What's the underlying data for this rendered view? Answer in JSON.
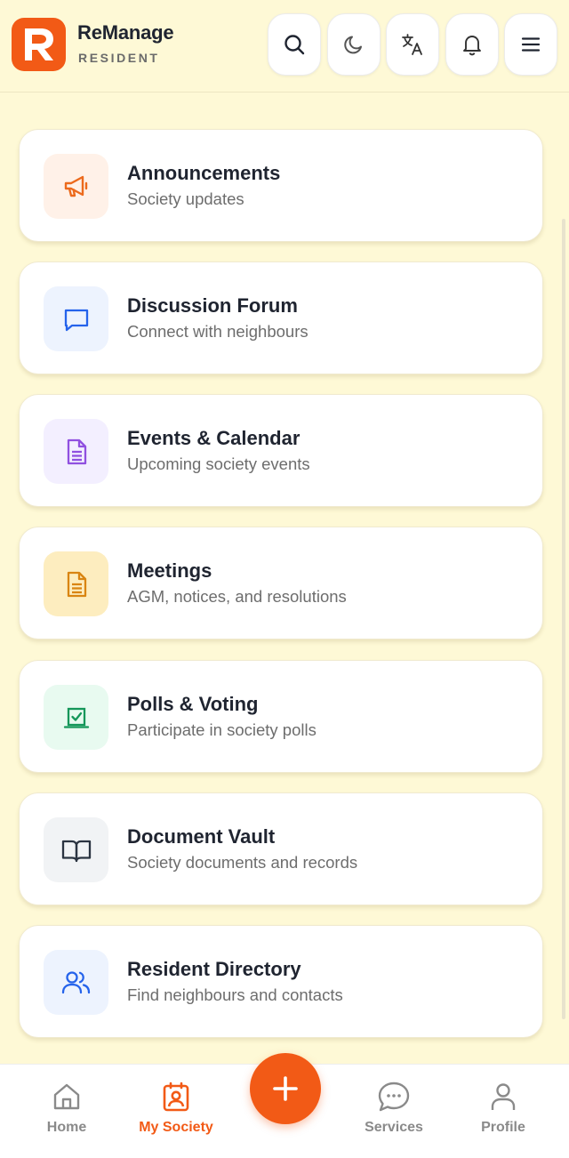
{
  "header": {
    "brand_name": "ReManage",
    "brand_sub": "RESIDENT",
    "icons": [
      "search-icon",
      "moon-icon",
      "translate-icon",
      "bell-icon",
      "menu-icon"
    ]
  },
  "cards": [
    {
      "title": "Announcements",
      "subtitle": "Society updates",
      "icon": "megaphone-icon",
      "icon_bg": "#fff1e8",
      "icon_color": "#ec6a1c"
    },
    {
      "title": "Discussion Forum",
      "subtitle": "Connect with neighbours",
      "icon": "chat-bubble-icon",
      "icon_bg": "#edf3fe",
      "icon_color": "#2563eb"
    },
    {
      "title": "Events & Calendar",
      "subtitle": "Upcoming society events",
      "icon": "document-icon",
      "icon_bg": "#f3efff",
      "icon_color": "#9050e0"
    },
    {
      "title": "Meetings",
      "subtitle": "AGM, notices, and resolutions",
      "icon": "document-icon",
      "icon_bg": "#fdedbf",
      "icon_color": "#d98512"
    },
    {
      "title": "Polls & Voting",
      "subtitle": "Participate in society polls",
      "icon": "vote-icon",
      "icon_bg": "#e8faf0",
      "icon_color": "#15965a"
    },
    {
      "title": "Document Vault",
      "subtitle": "Society documents and records",
      "icon": "book-icon",
      "icon_bg": "#f1f3f5",
      "icon_color": "#2b3441"
    },
    {
      "title": "Resident Directory",
      "subtitle": "Find neighbours and contacts",
      "icon": "users-icon",
      "icon_bg": "#edf3fe",
      "icon_color": "#2563eb"
    }
  ],
  "nav": {
    "home": "Home",
    "my_society": "My Society",
    "services": "Services",
    "profile": "Profile",
    "active": "My Society",
    "fab_icon": "plus-icon"
  },
  "colors": {
    "accent": "#f25a16",
    "background": "#fef9d6",
    "inactive_nav": "#8a8a8a"
  }
}
